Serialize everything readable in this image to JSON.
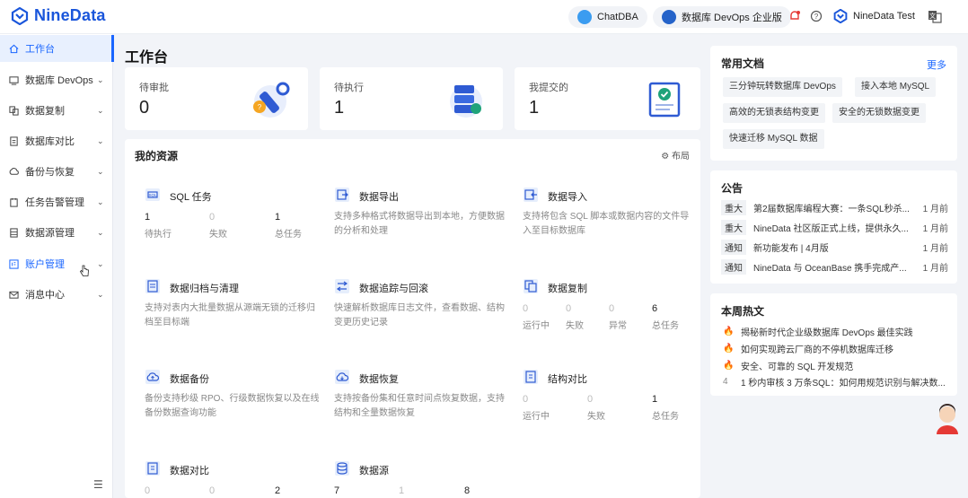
{
  "app": {
    "name": "NineData"
  },
  "topbar": {
    "chatdba": "ChatDBA",
    "edition": "数据库 DevOps 企业版",
    "user": "NineData Test"
  },
  "sidebar": {
    "items": [
      {
        "label": "工作台",
        "icon": "home-icon"
      },
      {
        "label": "数据库 DevOps",
        "icon": "devops-icon"
      },
      {
        "label": "数据复制",
        "icon": "copy-icon"
      },
      {
        "label": "数据库对比",
        "icon": "compare-icon"
      },
      {
        "label": "备份与恢复",
        "icon": "backup-icon"
      },
      {
        "label": "任务告警管理",
        "icon": "alarm-icon"
      },
      {
        "label": "数据源管理",
        "icon": "datasource-icon"
      },
      {
        "label": "账户管理",
        "icon": "account-icon"
      },
      {
        "label": "消息中心",
        "icon": "mail-icon"
      }
    ]
  },
  "page": {
    "title": "工作台"
  },
  "stats": [
    {
      "label": "待审批",
      "value": "0"
    },
    {
      "label": "待执行",
      "value": "1"
    },
    {
      "label": "我提交的",
      "value": "1"
    }
  ],
  "resources": {
    "title": "我的资源",
    "layout_label": "布局",
    "sql_task": {
      "title": "SQL 任务",
      "stats": [
        {
          "v": "1",
          "k": "待执行"
        },
        {
          "v": "0",
          "k": "失败"
        },
        {
          "v": "1",
          "k": "总任务"
        }
      ]
    },
    "export": {
      "title": "数据导出",
      "desc": "支持多种格式将数据导出到本地，方便数据的分析和处理"
    },
    "import": {
      "title": "数据导入",
      "desc": "支持将包含 SQL 脚本或数据内容的文件导入至目标数据库"
    },
    "archive": {
      "title": "数据归档与清理",
      "desc": "支持对表内大批量数据从源端无锁的迁移归档至目标端"
    },
    "trace": {
      "title": "数据追踪与回滚",
      "desc": "快速解析数据库日志文件，查看数据、结构变更历史记录"
    },
    "replication": {
      "title": "数据复制",
      "stats": [
        {
          "v": "0",
          "k": "运行中"
        },
        {
          "v": "0",
          "k": "失败"
        },
        {
          "v": "0",
          "k": "异常"
        },
        {
          "v": "6",
          "k": "总任务"
        }
      ]
    },
    "backup": {
      "title": "数据备份",
      "desc": "备份支持秒级 RPO、行级数据恢复以及在线备份数据查询功能"
    },
    "restore": {
      "title": "数据恢复",
      "desc": "支持按备份集和任意时间点恢复数据，支持结构和全量数据恢复"
    },
    "schema_compare": {
      "title": "结构对比",
      "stats": [
        {
          "v": "0",
          "k": "运行中"
        },
        {
          "v": "0",
          "k": "失败"
        },
        {
          "v": "1",
          "k": "总任务"
        }
      ]
    },
    "data_compare": {
      "title": "数据对比",
      "stats": [
        {
          "v": "0"
        },
        {
          "v": "0"
        },
        {
          "v": "2"
        }
      ]
    },
    "datasource": {
      "title": "数据源",
      "stats": [
        {
          "v": "7"
        },
        {
          "v": "1"
        },
        {
          "v": "8"
        }
      ]
    }
  },
  "docs": {
    "title": "常用文档",
    "more": "更多",
    "items": [
      "三分钟玩转数据库 DevOps",
      "接入本地 MySQL",
      "高效的无锁表结构变更",
      "安全的无锁数据变更",
      "快速迁移 MySQL 数据"
    ]
  },
  "notice": {
    "title": "公告",
    "items": [
      {
        "tag": "重大",
        "text": "第2届数据库编程大赛：一条SQL秒杀...",
        "date": "1 月前"
      },
      {
        "tag": "重大",
        "text": "NineData 社区版正式上线，提供永久...",
        "date": "1 月前"
      },
      {
        "tag": "通知",
        "text": "新功能发布 | 4月版",
        "date": "1 月前"
      },
      {
        "tag": "通知",
        "text": "NineData 与 OceanBase 携手完成产...",
        "date": "1 月前"
      }
    ]
  },
  "hot": {
    "title": "本周热文",
    "items": [
      {
        "rank": "",
        "text": "揭秘新时代企业级数据库 DevOps 最佳实践"
      },
      {
        "rank": "",
        "text": "如何实现跨云厂商的不停机数据库迁移"
      },
      {
        "rank": "",
        "text": "安全、可靠的 SQL 开发规范"
      },
      {
        "rank": "4",
        "text": "1 秒内审核 3 万条SQL：如何用规范识别与解决数..."
      }
    ]
  },
  "colors": {
    "accent": "#1a66ff",
    "brand": "#1a56db",
    "fire": "#e8452a"
  }
}
